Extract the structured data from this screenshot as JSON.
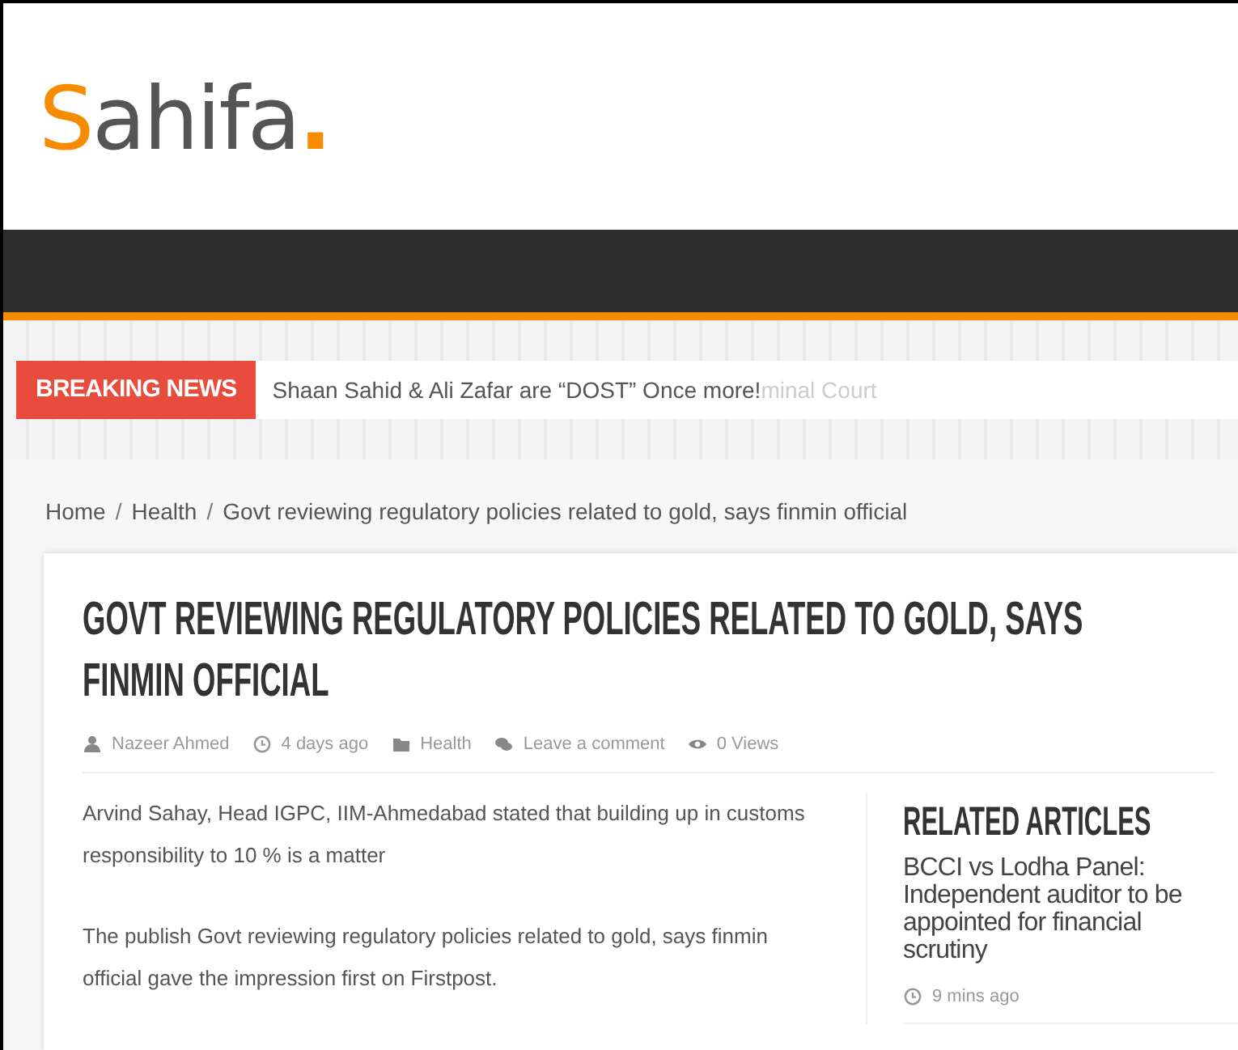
{
  "logo": {
    "initial": "S",
    "name": "ahifa",
    "dot": "."
  },
  "breaking_news": {
    "label": "BREAKING NEWS",
    "headline": "Shaan Sahid & Ali Zafar are “DOST” Once more!",
    "fading_text": "minal Court"
  },
  "breadcrumb_separator": "/",
  "breadcrumb": [
    "Home",
    "Health",
    "Govt reviewing regulatory policies related to gold, says finmin official"
  ],
  "article": {
    "title": "GOVT REVIEWING REGULATORY POLICIES RELATED TO GOLD, SAYS FINMIN OFFICIAL",
    "meta": [
      {
        "kind": "author",
        "text": "Nazeer Ahmed"
      },
      {
        "kind": "time",
        "text": "4 days ago"
      },
      {
        "kind": "category",
        "text": "Health"
      },
      {
        "kind": "comments",
        "text": "Leave a comment"
      },
      {
        "kind": "views",
        "text": "0 Views"
      }
    ],
    "paragraphs": [
      "Arvind Sahay, Head IGPC, IIM-Ahmedabad stated that building up in customs responsibility to 10 % is a matter",
      "The publish Govt reviewing regulatory policies related to gold, says finmin official gave the impression first on Firstpost."
    ]
  },
  "related": {
    "heading": "RELATED ARTICLES",
    "items": [
      {
        "title": "BCCI vs Lodha Panel: Independent auditor to be appointed for financial scrutiny",
        "time": "9 mins ago"
      }
    ]
  }
}
